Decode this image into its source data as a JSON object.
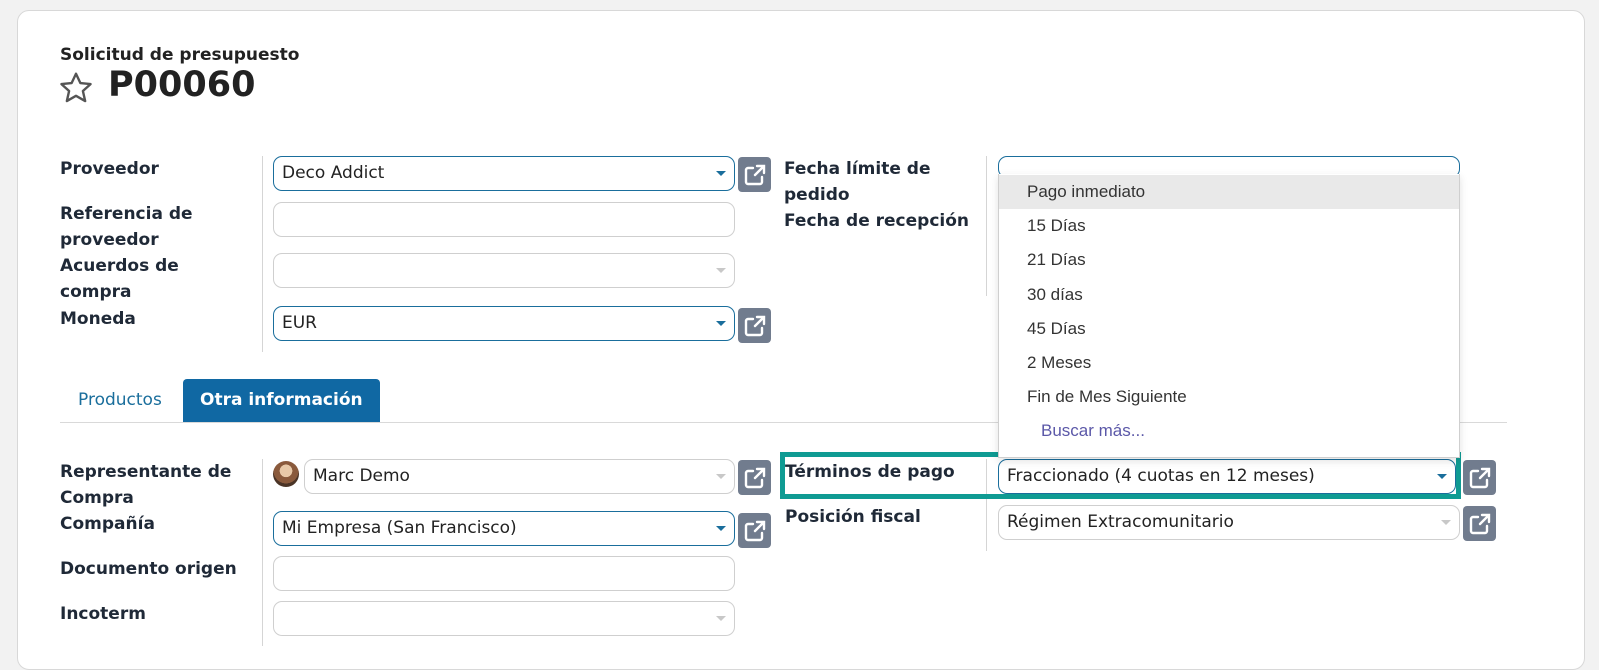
{
  "header": {
    "subtitle": "Solicitud de presupuesto",
    "title": "P00060"
  },
  "left_group": {
    "proveedor_label": "Proveedor",
    "proveedor_value": "Deco Addict",
    "referencia_label_1": "Referencia de",
    "referencia_label_2": "proveedor",
    "referencia_value": "",
    "acuerdos_label_1": "Acuerdos de",
    "acuerdos_label_2": "compra",
    "acuerdos_value": "",
    "moneda_label": "Moneda",
    "moneda_value": "EUR"
  },
  "right_group": {
    "fecha_limite_label_1": "Fecha límite de",
    "fecha_limite_label_2": "pedido",
    "fecha_recepcion_label": "Fecha de recepción"
  },
  "dropdown": {
    "items": [
      "Pago inmediato",
      "15 Días",
      "21 Días",
      "30 días",
      "45 Días",
      "2 Meses",
      "Fin de Mes Siguiente"
    ],
    "more": "Buscar más..."
  },
  "tabs": {
    "products": "Productos",
    "other_info": "Otra información"
  },
  "other_info": {
    "representante_label_1": "Representante de",
    "representante_label_2": "Compra",
    "representante_value": "Marc Demo",
    "compania_label": "Compañía",
    "compania_value": "Mi Empresa (San Francisco)",
    "documento_label": "Documento origen",
    "documento_value": "",
    "incoterm_label": "Incoterm",
    "incoterm_value": "",
    "terminos_label": "Términos de pago",
    "terminos_value": "Fraccionado (4 cuotas en 12 meses)",
    "posicion_label": "Posición fiscal",
    "posicion_value": "Régimen Extracomunitario"
  },
  "colors": {
    "accent": "#1068a3",
    "highlight": "#0f9b93",
    "button": "#717c8e"
  }
}
